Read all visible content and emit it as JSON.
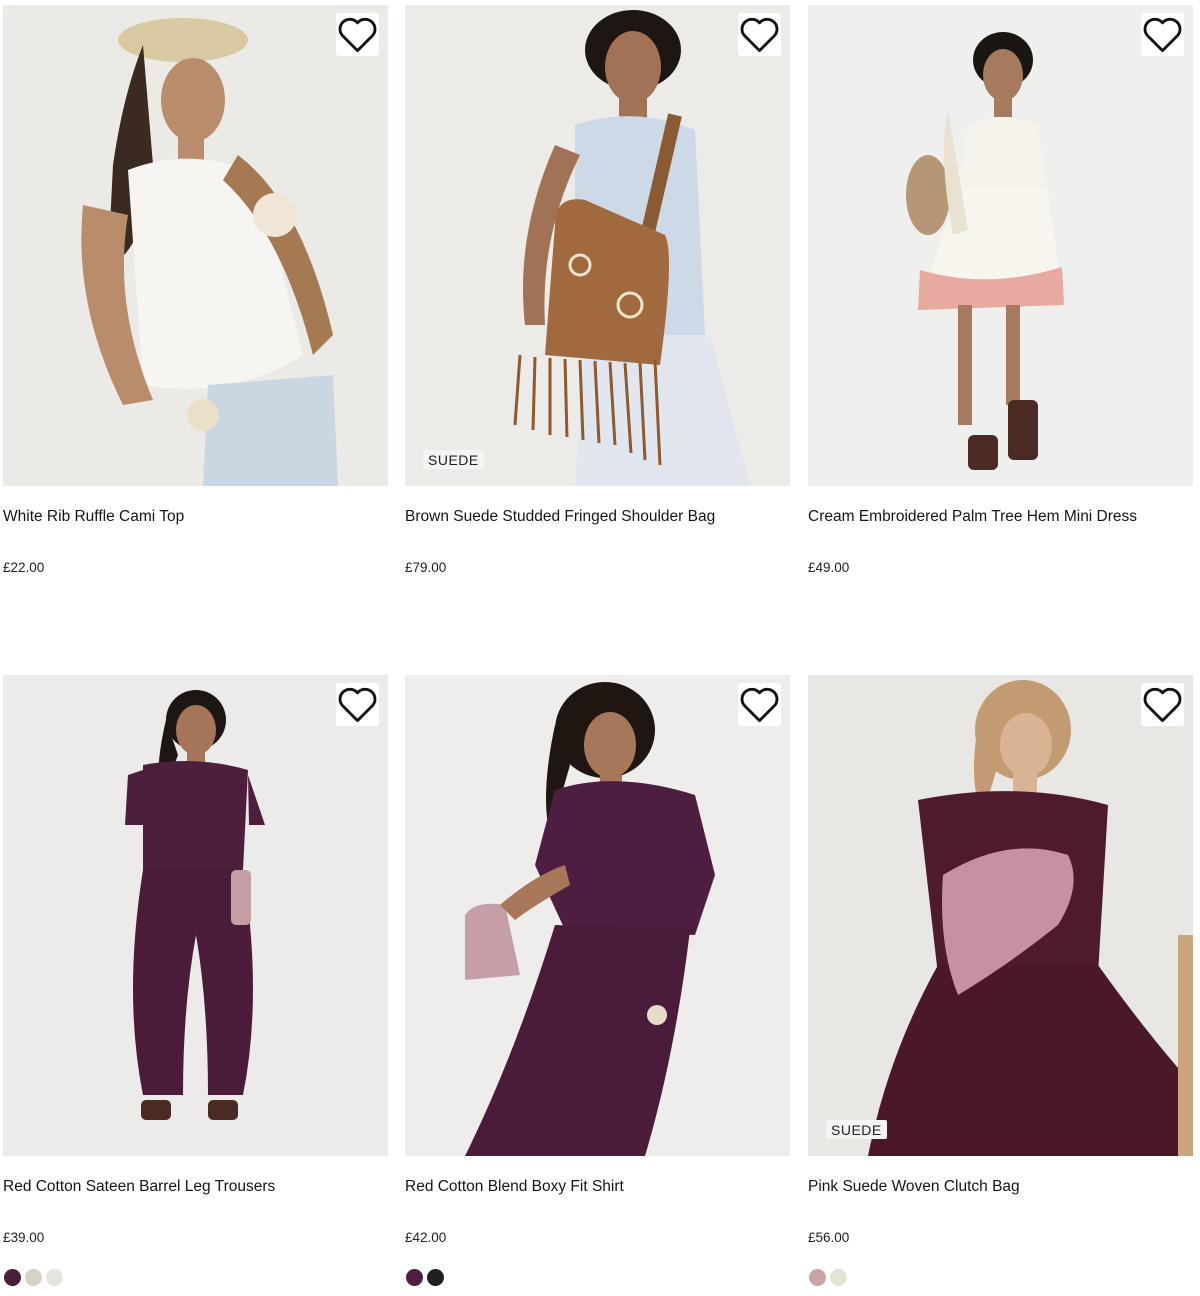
{
  "products": [
    {
      "name": "White Rib Ruffle Cami Top",
      "price": "£22.00",
      "badge": "",
      "bg": "#eceae6"
    },
    {
      "name": "Brown Suede Studded Fringed Shoulder Bag",
      "price": "£79.00",
      "badge": "SUEDE",
      "bg": "#ecebe8"
    },
    {
      "name": "Cream Embroidered Palm Tree Hem Mini Dress",
      "price": "£49.00",
      "badge": "",
      "bg": "#efefed"
    },
    {
      "name": "Red Cotton Sateen Barrel Leg Trousers",
      "price": "£39.00",
      "badge": "",
      "bg": "#ecebe9",
      "swatches": [
        "#4a1f3a",
        "#d6d2c8",
        "#e3e5e0"
      ]
    },
    {
      "name": "Red Cotton Blend Boxy Fit Shirt",
      "price": "£42.00",
      "badge": "",
      "bg": "#eeedeb",
      "swatches": [
        "#4e2142",
        "#1f1f22"
      ]
    },
    {
      "name": "Pink Suede Woven Clutch Bag",
      "price": "£56.00",
      "badge": "SUEDE",
      "bg": "#e8e7e4",
      "swatches": [
        "#c9a4a6",
        "#e1e5d2"
      ]
    }
  ],
  "icons": {
    "wishlist": "heart-outline-icon"
  }
}
